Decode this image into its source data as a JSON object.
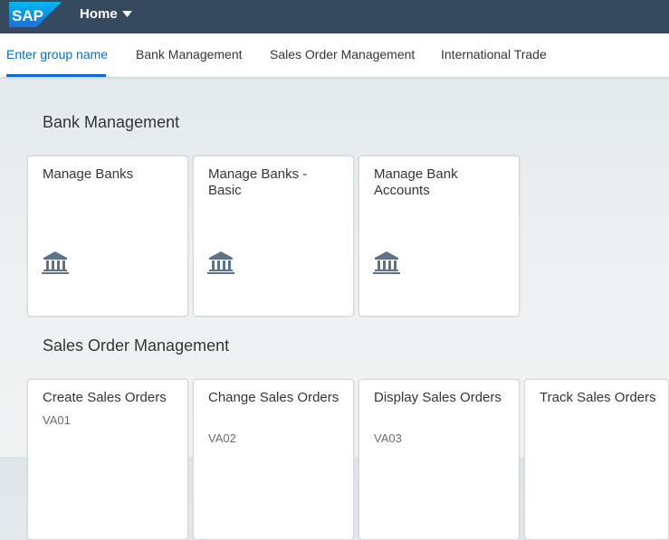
{
  "shell": {
    "logo_text": "SAP",
    "home_label": "Home"
  },
  "tabs": [
    {
      "label": "Enter group name",
      "active": true
    },
    {
      "label": "Bank Management"
    },
    {
      "label": "Sales Order Management"
    },
    {
      "label": "International Trade"
    }
  ],
  "groups": [
    {
      "title": "Bank Management",
      "tiles": [
        {
          "title": "Manage Banks",
          "icon": "bank-icon"
        },
        {
          "title": "Manage Banks - Basic",
          "icon": "bank-icon"
        },
        {
          "title": "Manage Bank Accounts",
          "icon": "bank-icon"
        }
      ]
    },
    {
      "title": "Sales Order Management",
      "tiles": [
        {
          "title": "Create Sales Orders",
          "subtitle": "VA01"
        },
        {
          "title": "Change Sales Orders",
          "subtitle": "VA02"
        },
        {
          "title": "Display Sales Orders",
          "subtitle": "VA03"
        },
        {
          "title": "Track Sales Orders"
        }
      ]
    }
  ],
  "colors": {
    "shell": "#354a5f",
    "accent": "#0a6ed1",
    "icon": "#5b738b"
  }
}
